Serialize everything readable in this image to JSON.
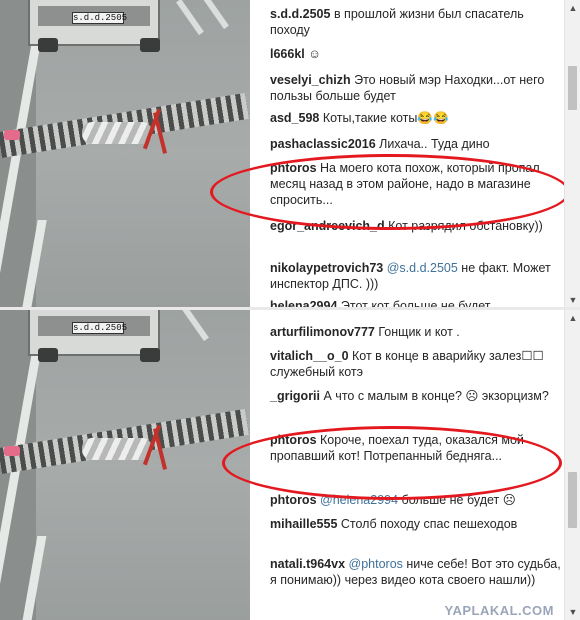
{
  "panel1": {
    "plate": "s.d.d.2505",
    "comments": [
      {
        "user": "s.d.d.2505",
        "text": "в прошлой жизни был спасатель походу"
      },
      {
        "user": "l666kl",
        "text": "☺"
      },
      {
        "user": "veselyi_chizh",
        "text": "Это новый мэр Находки...от него пользы больше будет"
      },
      {
        "user": "asd_598",
        "text": "Коты,такие коты😂😂"
      },
      {
        "user": "pashaclassic2016",
        "text": "Лихача.. Туда дино"
      },
      {
        "user": "phtoros",
        "text": "На моего кота похож, который пропал месяц назад в этом районе, надо в магазине спросить..."
      },
      {
        "user": "egor_andreevich_d",
        "text": "Кот разрядил обстановку))"
      },
      {
        "user": "nikolaypetrovich73",
        "mention": "@s.d.d.2505",
        "text": "не факт. Может инспектор ДПС. )))"
      },
      {
        "user": "helena2994",
        "text": "Этот кот больше не будет"
      }
    ]
  },
  "panel2": {
    "comments": [
      {
        "user": "arturfilimonov777",
        "text": "Гонщик и кот ."
      },
      {
        "user": "vitalich__o_0",
        "text": "Кот в конце в аварийку залез☐☐ служебный котэ"
      },
      {
        "user": "_grigorii",
        "text": "А что с малым в конце? ☹ экзорцизм?"
      },
      {
        "user": "phtoros",
        "text": "Короче, поехал туда, оказался мой пропавший кот! Потрепанный бедняга..."
      },
      {
        "user": "phtoros",
        "mention": "@helena2994",
        "text": "больше не будет ☹"
      },
      {
        "user": "mihaille555",
        "text": "Столб походу спас пешеходов"
      },
      {
        "user": "natali.t964vx",
        "mention": "@phtoros",
        "text": "ниче себе! Вот это судьба, я понимаю)) через видео кота своего нашли))"
      }
    ]
  },
  "scroll_up_icon": "▲",
  "scroll_down_icon": "▼",
  "watermark": "YAPLAKAL.COM",
  "colors": {
    "ellipse": "#e4191f",
    "mention": "#3f729b",
    "username": "#262626"
  }
}
